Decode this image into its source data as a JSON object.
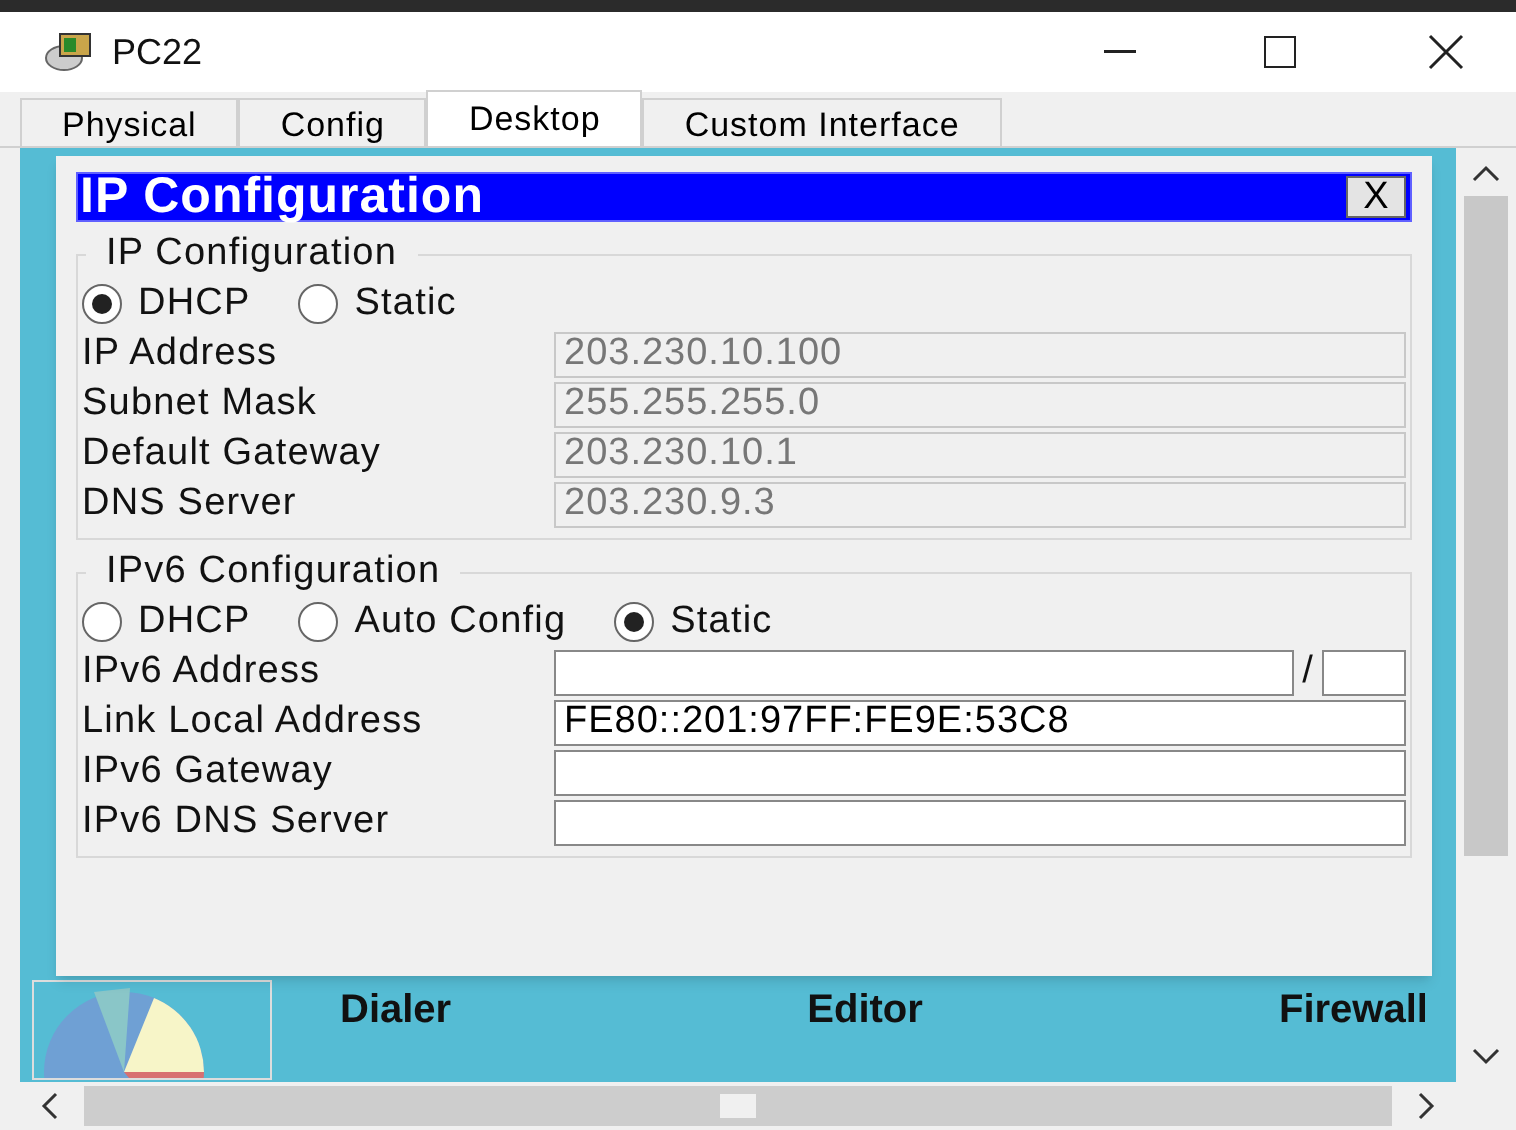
{
  "window": {
    "title": "PC22"
  },
  "tabs": [
    {
      "label": "Physical",
      "selected": false
    },
    {
      "label": "Config",
      "selected": false
    },
    {
      "label": "Desktop",
      "selected": true
    },
    {
      "label": "Custom Interface",
      "selected": false
    }
  ],
  "desktop_apps": [
    {
      "label": "Dialer"
    },
    {
      "label": "Editor"
    },
    {
      "label": "Firewall"
    }
  ],
  "dialog": {
    "title": "IP Configuration",
    "close": "X",
    "sections": [
      {
        "legend": "IP Configuration",
        "modes": [
          {
            "label": "DHCP",
            "selected": true
          },
          {
            "label": "Static",
            "selected": false
          }
        ],
        "fields": [
          {
            "kind": "text",
            "label": "IP Address",
            "value": "203.230.10.100",
            "disabled": true
          },
          {
            "kind": "text",
            "label": "Subnet Mask",
            "value": "255.255.255.0",
            "disabled": true
          },
          {
            "kind": "text",
            "label": "Default Gateway",
            "value": "203.230.10.1",
            "disabled": true
          },
          {
            "kind": "text",
            "label": "DNS Server",
            "value": "203.230.9.3",
            "disabled": true
          }
        ]
      },
      {
        "legend": "IPv6 Configuration",
        "modes": [
          {
            "label": "DHCP",
            "selected": false
          },
          {
            "label": "Auto Config",
            "selected": false
          },
          {
            "label": "Static",
            "selected": true
          }
        ],
        "fields": [
          {
            "kind": "prefix",
            "label": "IPv6 Address",
            "separator": "/",
            "disabled": false
          },
          {
            "kind": "text",
            "label": "Link Local Address",
            "value": "FE80::201:97FF:FE9E:53C8",
            "disabled": false
          },
          {
            "kind": "text",
            "label": "IPv6 Gateway",
            "disabled": false
          },
          {
            "kind": "text",
            "label": "IPv6 DNS Server",
            "disabled": false
          }
        ]
      }
    ]
  }
}
